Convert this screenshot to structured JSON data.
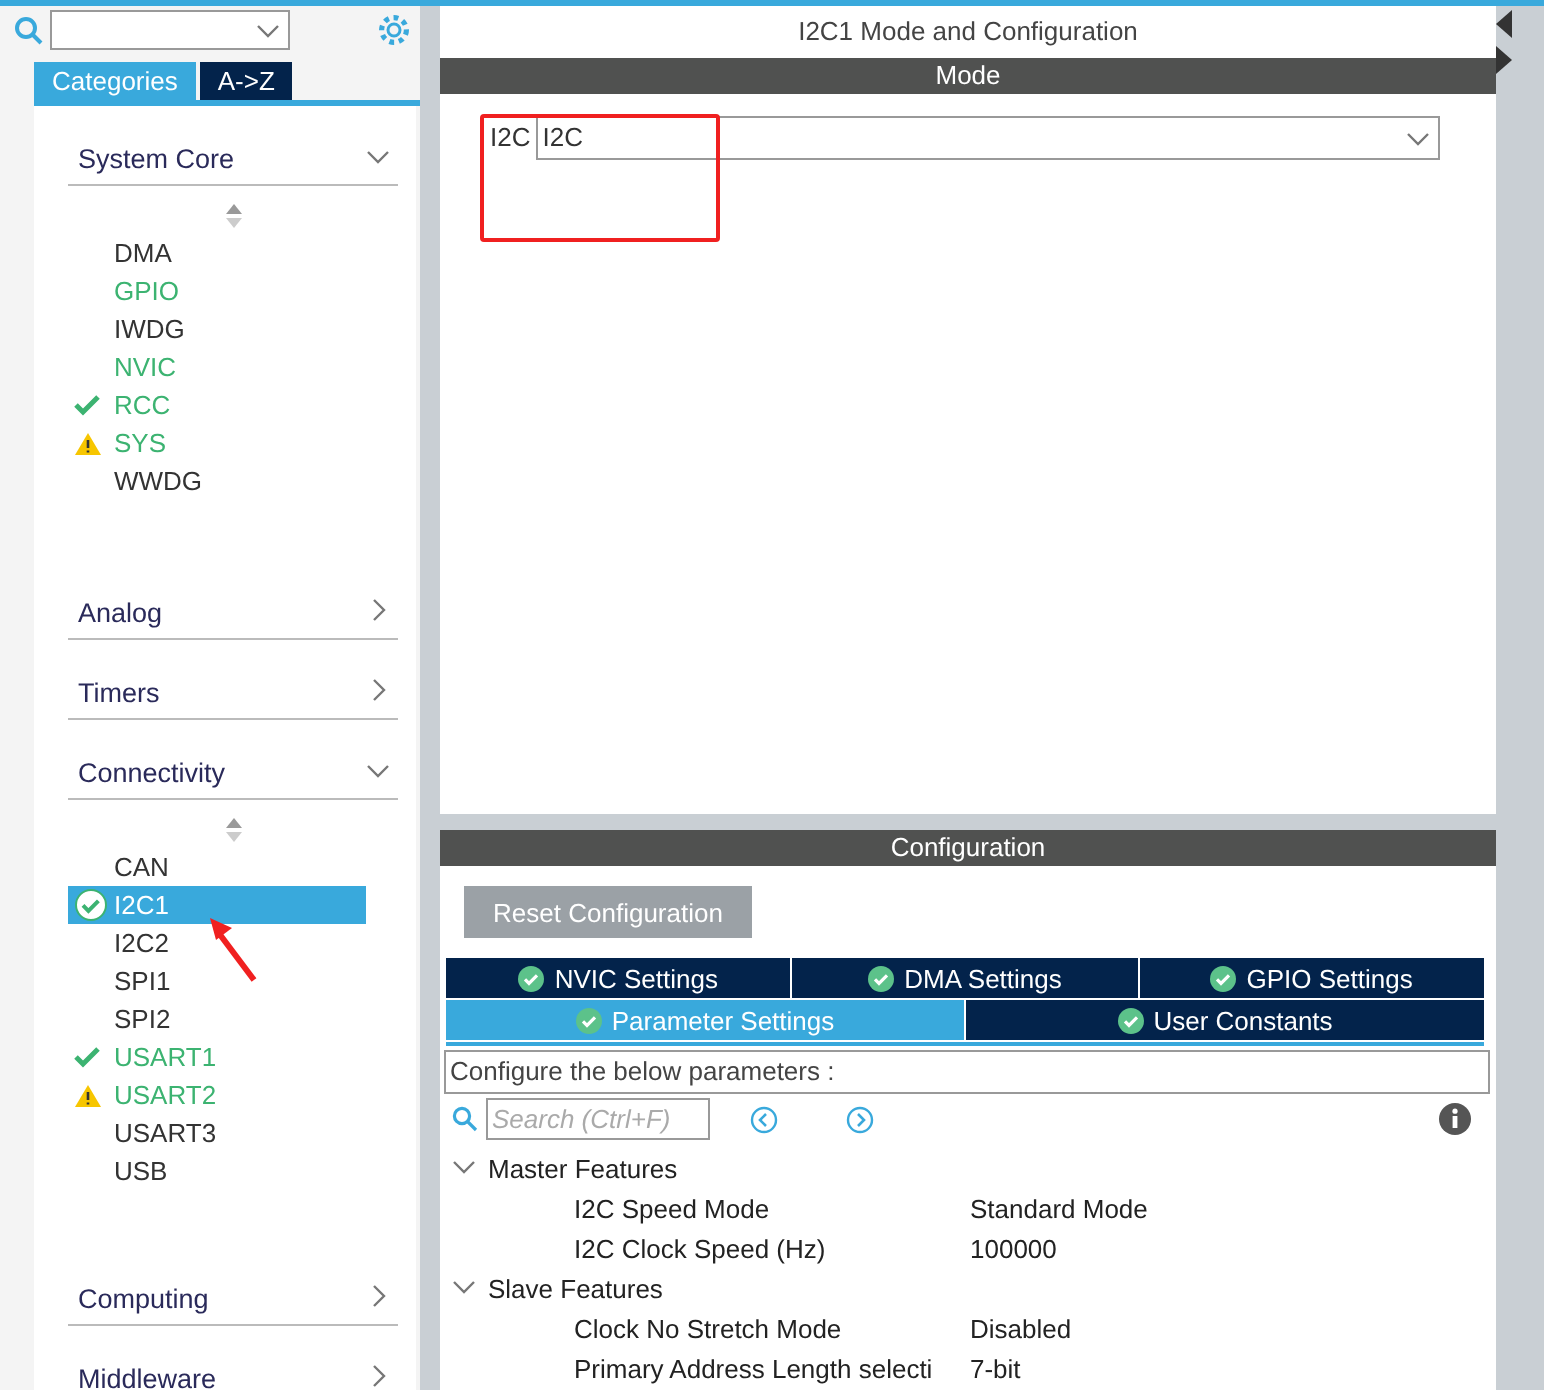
{
  "view_tabs": [
    {
      "label": "Categories",
      "selected": true
    },
    {
      "label": "A->Z",
      "selected": false
    }
  ],
  "categories": [
    {
      "label": "System Core",
      "expanded": true,
      "items": [
        {
          "label": "DMA",
          "kind": "plain",
          "selected": false
        },
        {
          "label": "GPIO",
          "kind": "active",
          "selected": false
        },
        {
          "label": "IWDG",
          "kind": "plain",
          "selected": false
        },
        {
          "label": "NVIC",
          "kind": "active",
          "selected": false
        },
        {
          "label": "RCC",
          "kind": "ok",
          "selected": false
        },
        {
          "label": "SYS",
          "kind": "warning",
          "selected": false
        },
        {
          "label": "WWDG",
          "kind": "plain",
          "selected": false
        }
      ]
    },
    {
      "label": "Analog",
      "expanded": false
    },
    {
      "label": "Timers",
      "expanded": false
    },
    {
      "label": "Connectivity",
      "expanded": true,
      "items": [
        {
          "label": "CAN",
          "kind": "plain",
          "selected": false
        },
        {
          "label": "I2C1",
          "kind": "ok",
          "selected": true
        },
        {
          "label": "I2C2",
          "kind": "plain",
          "selected": false
        },
        {
          "label": "SPI1",
          "kind": "plain",
          "selected": false
        },
        {
          "label": "SPI2",
          "kind": "plain",
          "selected": false
        },
        {
          "label": "USART1",
          "kind": "ok",
          "selected": false
        },
        {
          "label": "USART2",
          "kind": "warning",
          "selected": false
        },
        {
          "label": "USART3",
          "kind": "plain",
          "selected": false
        },
        {
          "label": "USB",
          "kind": "plain",
          "selected": false
        }
      ]
    },
    {
      "label": "Computing",
      "expanded": false
    },
    {
      "label": "Middleware",
      "expanded": false
    }
  ],
  "title": "I2C1 Mode and Configuration",
  "mode": {
    "header": "Mode",
    "label": "I2C",
    "value": "I2C"
  },
  "configuration": {
    "header": "Configuration",
    "reset_button": "Reset Configuration",
    "tab_rows": [
      [
        {
          "label": "NVIC Settings",
          "selected": false
        },
        {
          "label": "DMA Settings",
          "selected": false
        },
        {
          "label": "GPIO Settings",
          "selected": false
        }
      ],
      [
        {
          "label": "Parameter Settings",
          "selected": true
        },
        {
          "label": "User Constants",
          "selected": false
        }
      ]
    ],
    "description": "Configure the below parameters :",
    "search": {
      "placeholder": "Search (Ctrl+F)"
    },
    "groups": [
      {
        "label": "Master Features",
        "expanded": true,
        "params": [
          {
            "name": "I2C Speed Mode",
            "value": "Standard Mode"
          },
          {
            "name": "I2C Clock Speed (Hz)",
            "value": "100000"
          }
        ]
      },
      {
        "label": "Slave Features",
        "expanded": true,
        "params": [
          {
            "name": "Clock No Stretch Mode",
            "value": "Disabled"
          },
          {
            "name": "Primary Address Length selecti",
            "value": "7-bit"
          }
        ]
      }
    ]
  }
}
